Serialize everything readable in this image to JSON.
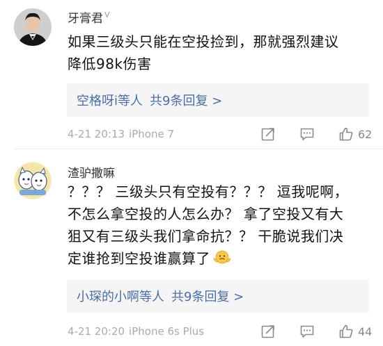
{
  "comments": [
    {
      "username": "牙膏君",
      "verify_mark": "V",
      "content_lines": [
        "如果三级头只能在空投捡到，那就强烈建议",
        "降低98k伤害"
      ],
      "reply_users": "空格呀i等人",
      "reply_count": "共9条回复 >",
      "time": "4-21 20:13",
      "device": "iPhone 7",
      "likes": "62",
      "avatar_icon": "man-portrait-avatar"
    },
    {
      "username": "渣驴撒嘛",
      "content_lines": [
        "？？？ 三级头只有空投有？？？ 逗我呢啊，",
        "不怎么拿空投的人怎么办？ 拿了空投又有大",
        "狙又有三级头我们拿命抗？？ 干脆说我们决",
        "定谁抢到空投谁赢算了"
      ],
      "emoji": "shrug-emoji",
      "reply_users": "小琛的小啊等人",
      "reply_count": "共9条回复 >",
      "time": "4-21 20:20",
      "device": "iPhone 6s Plus",
      "likes": "44",
      "avatar_icon": "cartoon-cats-avatar"
    }
  ],
  "icons": {
    "share": "share-icon",
    "comment": "comment-icon",
    "like": "thumbs-up-icon"
  },
  "colors": {
    "link_blue": "#4a6fa5",
    "meta_gray": "#aaaaaa",
    "reply_bg": "#f5f5f5"
  }
}
